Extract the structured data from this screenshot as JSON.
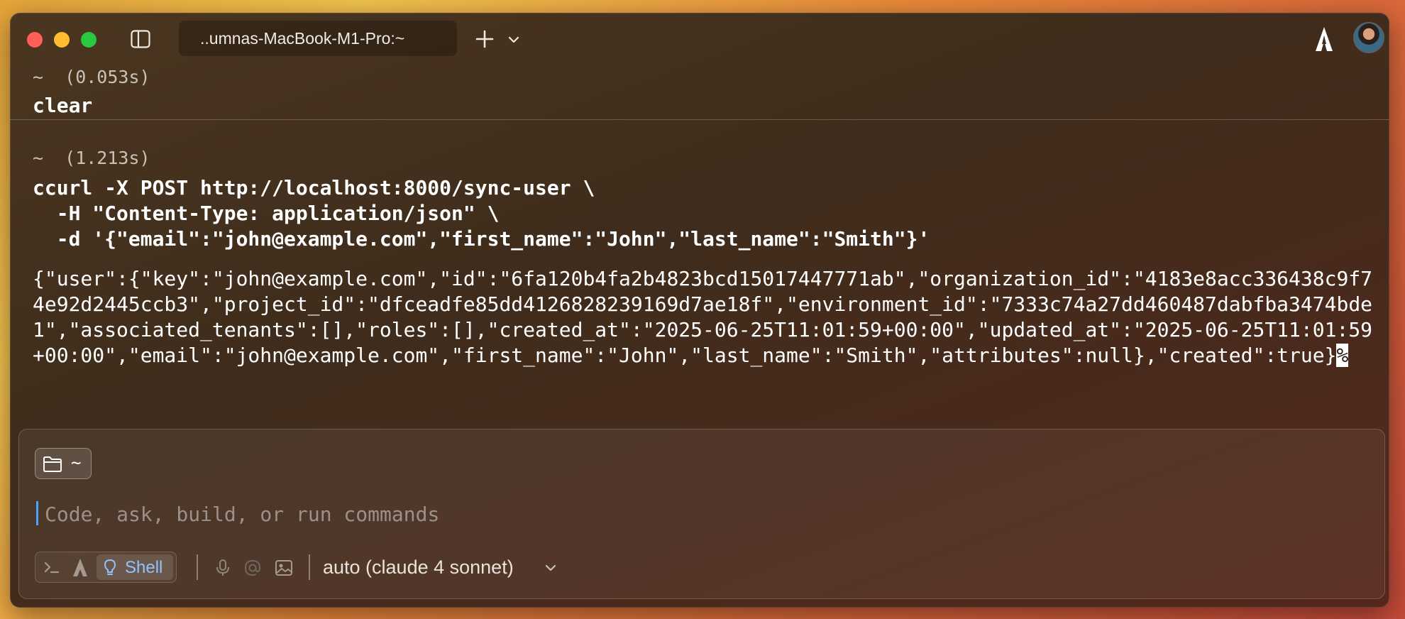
{
  "window": {
    "tab_title": "..umnas-MacBook-M1-Pro:~"
  },
  "blocks": [
    {
      "meta": "~  (0.053s)",
      "command": "clear"
    },
    {
      "meta": "~  (1.213s)",
      "command_lines": [
        "ccurl -X POST http://localhost:8000/sync-user \\",
        "  -H \"Content-Type: application/json\" \\",
        "  -d '{\"email\":\"john@example.com\",\"first_name\":\"John\",\"last_name\":\"Smith\"}'"
      ],
      "output": "{\"user\":{\"key\":\"john@example.com\",\"id\":\"6fa120b4fa2b4823bcd15017447771ab\",\"organization_id\":\"4183e8acc336438c9f74e92d2445ccb3\",\"project_id\":\"dfceadfe85dd4126828239169d7ae18f\",\"environment_id\":\"7333c74a27dd460487dabfba3474bde1\",\"associated_tenants\":[],\"roles\":[],\"created_at\":\"2025-06-25T11:01:59+00:00\",\"updated_at\":\"2025-06-25T11:01:59+00:00\",\"email\":\"john@example.com\",\"first_name\":\"John\",\"last_name\":\"Smith\",\"attributes\":null},\"created\":true}",
      "output_end_marker": "%"
    }
  ],
  "input": {
    "directory": "~",
    "placeholder": "Code, ask, build, or run commands",
    "mode_label": "Shell",
    "model": "auto (claude 4 sonnet)"
  },
  "colors": {
    "accent": "#8fc3ff",
    "cursor": "#4aa3ff",
    "close": "#ff5f57",
    "minimize": "#febc2e",
    "zoom": "#28c840"
  },
  "icons": [
    "sidebar-toggle-icon",
    "plus-icon",
    "chevron-down-icon",
    "agent-logo-icon",
    "avatar",
    "folder-icon",
    "terminal-prompt-icon",
    "agent-mode-icon",
    "lightbulb-icon",
    "microphone-icon",
    "at-sign-icon",
    "image-icon"
  ]
}
